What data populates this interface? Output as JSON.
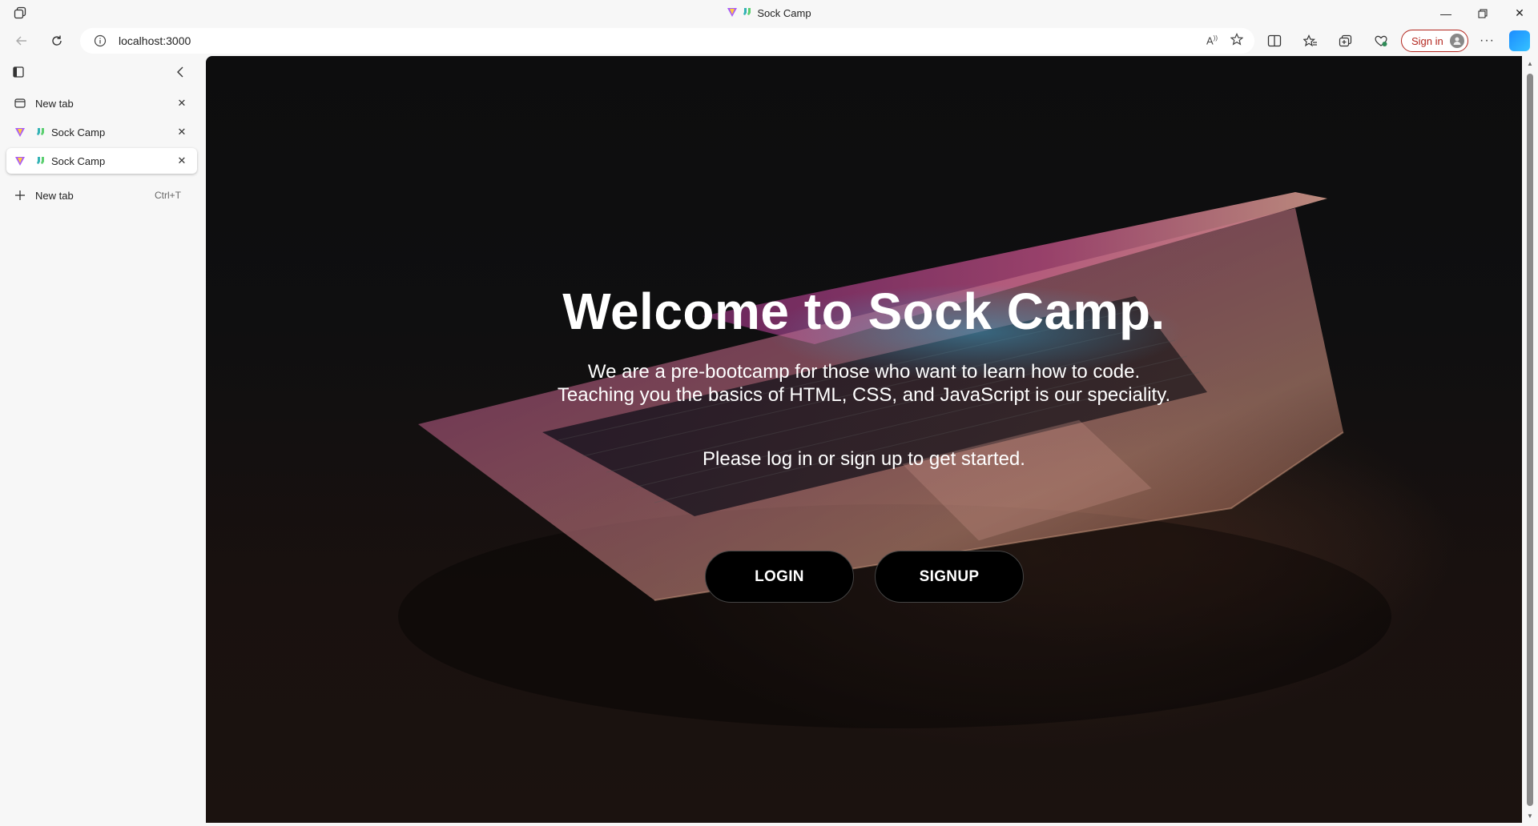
{
  "window": {
    "title": "Sock Camp"
  },
  "address_bar": {
    "url": "localhost:3000"
  },
  "toolbar": {
    "sign_in_label": "Sign in"
  },
  "sidebar": {
    "tabs": [
      {
        "label": "New tab",
        "active": false
      },
      {
        "label": "Sock Camp",
        "active": false
      },
      {
        "label": "Sock Camp",
        "active": true
      }
    ],
    "new_tab_label": "New tab",
    "new_tab_shortcut": "Ctrl+T"
  },
  "page": {
    "heading": "Welcome to Sock Camp.",
    "subtitle_line1": "We are a pre-bootcamp for those who want to learn how to code.",
    "subtitle_line2": "Teaching you the basics of HTML, CSS, and JavaScript is our speciality.",
    "cta": "Please log in or sign up to get started.",
    "login_label": "LOGIN",
    "signup_label": "SIGNUP"
  },
  "colors": {
    "accent_signin": "#b3261e",
    "hero_text": "#ffffff",
    "button_bg": "#000000"
  }
}
